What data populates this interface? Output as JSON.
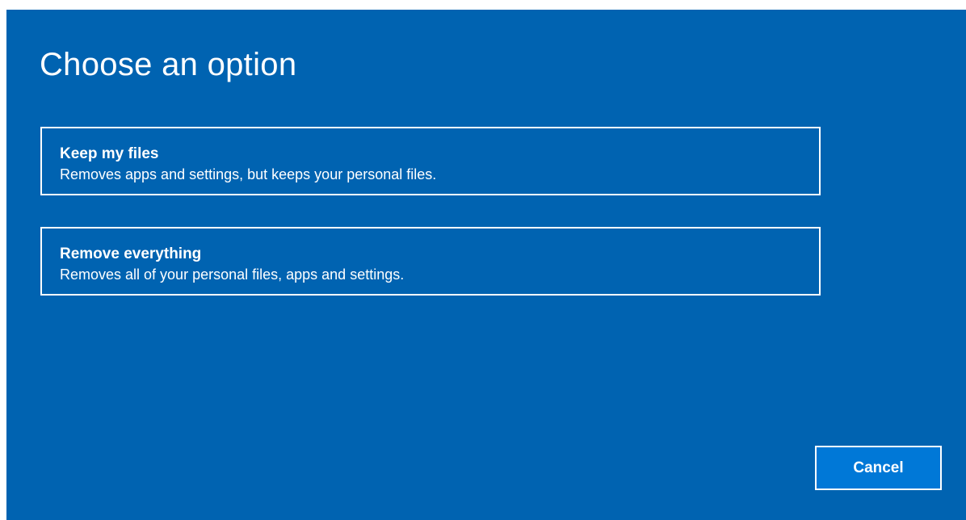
{
  "dialog": {
    "title": "Choose an option",
    "background_color": "#0063b1"
  },
  "options": [
    {
      "title": "Keep my files",
      "description": "Removes apps and settings, but keeps your personal files."
    },
    {
      "title": "Remove everything",
      "description": "Removes all of your personal files, apps and settings."
    }
  ],
  "buttons": {
    "cancel_label": "Cancel",
    "cancel_color": "#0078d7"
  }
}
